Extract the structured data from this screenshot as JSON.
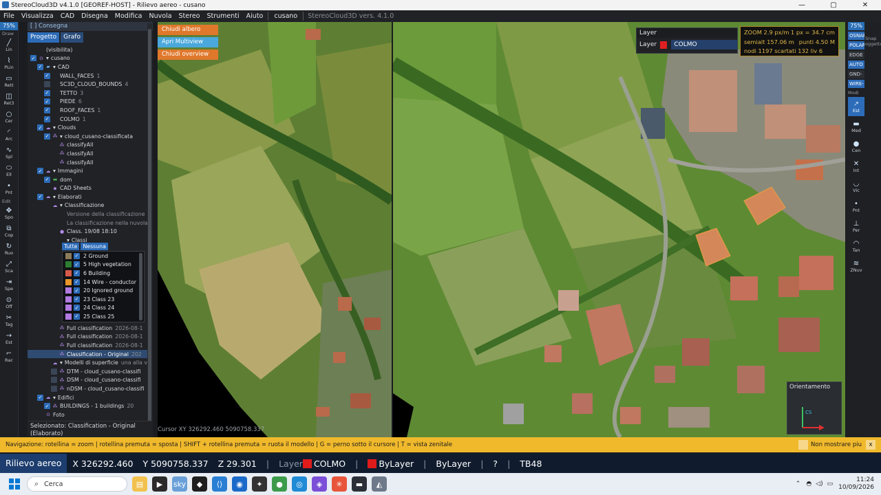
{
  "window": {
    "title": "StereoCloud3D v4.1.0  [GEOREF-HOST]  - Rilievo aereo  - cusano",
    "controls": [
      "—",
      "▢",
      "✕"
    ]
  },
  "menu": {
    "items": [
      "File",
      "Visualizza",
      "CAD",
      "Disegna",
      "Modifica",
      "Nuvola",
      "Stereo",
      "Strumenti",
      "Aiuto"
    ],
    "project_tab": "cusano",
    "version": "StereoCloud3D vers. 4.1.0"
  },
  "left_tools": {
    "zoom": "75%",
    "group_draw": "Draw",
    "group_edit": "Edit",
    "draw": [
      {
        "g": "╱",
        "l": "Lin"
      },
      {
        "g": "⌇",
        "l": "PLin"
      },
      {
        "g": "▭",
        "l": "Rett"
      },
      {
        "g": "◫",
        "l": "Ret3"
      },
      {
        "g": "○",
        "l": "Cer"
      },
      {
        "g": "◜",
        "l": "Arc"
      },
      {
        "g": "∿",
        "l": "Spl"
      },
      {
        "g": "⬭",
        "l": "Ell"
      },
      {
        "g": "•",
        "l": "Pnt"
      }
    ],
    "edit": [
      {
        "g": "✥",
        "l": "Spo"
      },
      {
        "g": "⧉",
        "l": "Cop"
      },
      {
        "g": "↻",
        "l": "Ruo"
      },
      {
        "g": "⤢",
        "l": "Sca"
      },
      {
        "g": "⇥",
        "l": "Spe"
      },
      {
        "g": "⊙",
        "l": "Off"
      },
      {
        "g": "✂",
        "l": "Tag"
      },
      {
        "g": "→",
        "l": "Est"
      },
      {
        "g": "⌐",
        "l": "Rac"
      }
    ]
  },
  "panel": {
    "header": "[ ] Consegna",
    "tabs": [
      "Progetto",
      "Grafo"
    ],
    "tree": [
      {
        "d": 0,
        "ck": 0,
        "ico": "",
        "t": "(visibilita)",
        "c": ""
      },
      {
        "d": 0,
        "ck": 1,
        "ico": "⊙",
        "arr": "▾",
        "t": "cusano",
        "c": ""
      },
      {
        "d": 1,
        "ck": 1,
        "ico": "▰",
        "arr": "▾",
        "t": "CAD",
        "c": ""
      },
      {
        "d": 2,
        "ck": 1,
        "ico": "",
        "t": "WALL_FACES",
        "c": "1"
      },
      {
        "d": 2,
        "ck": 2,
        "ico": "",
        "t": "SC3D_CLOUD_BOUNDS",
        "c": "4"
      },
      {
        "d": 2,
        "ck": 1,
        "ico": "",
        "t": "TETTO",
        "c": "3"
      },
      {
        "d": 2,
        "ck": 1,
        "ico": "",
        "t": "PIEDE",
        "c": "6"
      },
      {
        "d": 2,
        "ck": 1,
        "ico": "",
        "t": "ROOF_FACES",
        "c": "1"
      },
      {
        "d": 2,
        "ck": 1,
        "ico": "",
        "t": "COLMO",
        "c": "1"
      },
      {
        "d": 1,
        "ck": 1,
        "ico": "☁",
        "arr": "▾",
        "t": "Clouds",
        "c": ""
      },
      {
        "d": 2,
        "ck": 1,
        "ico": "⁂",
        "arr": "▾",
        "t": "cloud_cusano-classificata",
        "c": ""
      },
      {
        "d": 3,
        "ck": 0,
        "ico": "⁂",
        "t": "classifyAll",
        "c": ""
      },
      {
        "d": 3,
        "ck": 0,
        "ico": "⁂",
        "t": "classifyAll",
        "c": ""
      },
      {
        "d": 3,
        "ck": 0,
        "ico": "⁂",
        "t": "classifyAll",
        "c": ""
      },
      {
        "d": 1,
        "ck": 1,
        "ico": "☁",
        "arr": "▾",
        "t": "Immagini",
        "c": ""
      },
      {
        "d": 2,
        "ck": 1,
        "ico": "▬",
        "t": "dom",
        "c": ""
      },
      {
        "d": 2,
        "ck": 0,
        "ico": "▪",
        "t": "CAD Sheets",
        "c": ""
      },
      {
        "d": 1,
        "ck": 1,
        "ico": "☁",
        "arr": "▾",
        "t": "Elaborati",
        "c": ""
      },
      {
        "d": 2,
        "ck": 0,
        "ico": "☁",
        "arr": "▾",
        "t": "Classificazione",
        "c": ""
      },
      {
        "d": 3,
        "ck": 0,
        "ico": "",
        "t": "Versione della classificazione",
        "c": "",
        "dim": 1
      },
      {
        "d": 3,
        "ck": 0,
        "ico": "",
        "t": "La classificazione nella nuvola non corri",
        "c": "",
        "dim": 1
      },
      {
        "d": 3,
        "ck": 0,
        "ico": "●",
        "t": "Class. 19/08 18:10",
        "c": ""
      },
      {
        "d": 3,
        "ck": 0,
        "ico": "",
        "arr": "▾",
        "t": "Classi",
        "c": ""
      }
    ],
    "class_buttons": [
      "Tutte",
      "Nessuna"
    ],
    "classes": [
      {
        "c": "#8b7b5a",
        "t": "2  Ground"
      },
      {
        "c": "#2e7d32",
        "t": "5  High vegetation"
      },
      {
        "c": "#d65a4a",
        "t": "6  Building"
      },
      {
        "c": "#e8952a",
        "t": "14  Wire - conductor"
      },
      {
        "c": "#b07ae0",
        "t": "20  Ignored ground"
      },
      {
        "c": "#b07ae0",
        "t": "23  Class 23"
      },
      {
        "c": "#b07ae0",
        "t": "24  Class 24"
      },
      {
        "c": "#b07ae0",
        "t": "25  Class 25"
      }
    ],
    "tree2": [
      {
        "d": 3,
        "ck": 0,
        "ico": "⁂",
        "t": "Full classification",
        "c": "2026-08-1",
        "sel": 0
      },
      {
        "d": 3,
        "ck": 0,
        "ico": "⁂",
        "t": "Full classification",
        "c": "2026-08-1",
        "sel": 0
      },
      {
        "d": 3,
        "ck": 0,
        "ico": "⁂",
        "t": "Full classification",
        "c": "2026-08-1",
        "sel": 0
      },
      {
        "d": 3,
        "ck": 0,
        "ico": "⁂",
        "t": "Classification - Original",
        "c": "202",
        "sel": 1
      },
      {
        "d": 2,
        "ck": 0,
        "ico": "☁",
        "arr": "▾",
        "t": "Modelli di superficie",
        "c": "una alla v",
        "sel": 0
      },
      {
        "d": 3,
        "ck": 2,
        "ico": "⁂",
        "t": "DTM - cloud_cusano-classifi",
        "c": "",
        "sel": 0
      },
      {
        "d": 3,
        "ck": 2,
        "ico": "⁂",
        "t": "DSM - cloud_cusano-classifi",
        "c": "",
        "sel": 0
      },
      {
        "d": 3,
        "ck": 2,
        "ico": "⁂",
        "t": "nDSM - cloud_cusano-classifi",
        "c": "",
        "sel": 0
      },
      {
        "d": 1,
        "ck": 1,
        "ico": "☁",
        "arr": "▾",
        "t": "Edifici",
        "c": "",
        "sel": 0
      },
      {
        "d": 2,
        "ck": 1,
        "ico": "⁂",
        "t": "BUILDINGS - 1 buildings",
        "c": "20",
        "sel": 0
      },
      {
        "d": 1,
        "ck": 0,
        "ico": "⊙",
        "t": "Foto",
        "c": "",
        "sel": 0
      }
    ],
    "selected": "Selezionato: Classification - Original (Elaborato)"
  },
  "viewport_left": {
    "buttons": [
      {
        "t": "Chiudi albero scena",
        "c": "#e0782c"
      },
      {
        "t": "Apri Multiview",
        "c": "#4aa8dc"
      },
      {
        "t": "Chiudi overview",
        "c": "#e0782c"
      }
    ],
    "cursor": "Cursor XY  326292.460  5090758.337"
  },
  "layer": {
    "title": "Layer",
    "label": "Layer",
    "value": "COLMO",
    "color": "#e02020"
  },
  "zoom_info": {
    "l1a": "ZOOM  2.9 px/m",
    "l1b": "1 px = 34.7 cm",
    "l2a": "semialt 157.06 m",
    "l2b": "punti 4.50 M",
    "l3": "nodi 1197  scartati 132  liv 6"
  },
  "snap": {
    "zoom": "75%",
    "title": "Snap oggetto",
    "items": [
      {
        "t": "OSNAP",
        "on": 1
      },
      {
        "t": "POLAR",
        "on": 1
      },
      {
        "t": "EDGE",
        "on": 0
      },
      {
        "t": "AUTO",
        "on": 1
      },
      {
        "t": "GND-Z",
        "on": 0
      },
      {
        "t": "WIRE-Z",
        "on": 1
      }
    ],
    "mod_label": "Modi",
    "tools": [
      {
        "g": "↗",
        "l": "Est",
        "on": 1
      },
      {
        "g": "▬",
        "l": "Med",
        "on": 0
      },
      {
        "g": "●",
        "l": "Cen",
        "on": 0
      },
      {
        "g": "✕",
        "l": "Int",
        "on": 0
      },
      {
        "g": "◡",
        "l": "Vic",
        "on": 0
      },
      {
        "g": "•",
        "l": "Pnt",
        "on": 0
      },
      {
        "g": "⊥",
        "l": "Per",
        "on": 0
      },
      {
        "g": "◠",
        "l": "Tan",
        "on": 0
      },
      {
        "g": "≋",
        "l": "ZNuv",
        "on": 0
      }
    ]
  },
  "orientation": {
    "title": "Orientamento",
    "cs": "CS"
  },
  "navbar": {
    "text": "Navigazione:  rotellina = zoom   |   rotellina premuta = sposta   |   SHIFT + rotellina premuta = ruota il modello   |   G = perno sotto il cursore   |   T = vista zenitale",
    "dont_show": "Non mostrare piu",
    "close": "x"
  },
  "status": {
    "mode": "Rilievo aereo",
    "x": "X 326292.460",
    "y": "Y 5090758.337",
    "z": "Z 29.301",
    "layer_lbl": "Layer",
    "layer": "COLMO",
    "bylayer1": "ByLayer",
    "bylayer2": "ByLayer",
    "help": "?",
    "tb": "TB48",
    "sep": "|"
  },
  "taskbar": {
    "search": "Cerca",
    "time": "11:24",
    "date": "10/09/2026",
    "apps": [
      {
        "g": "▤",
        "c": "#f2c14e"
      },
      {
        "g": "▶",
        "c": "#2b2b2b"
      },
      {
        "g": "sky",
        "c": "#6aa0d8"
      },
      {
        "g": "◆",
        "c": "#1f1f1f"
      },
      {
        "g": "⟨⟩",
        "c": "#2a7fd4"
      },
      {
        "g": "◉",
        "c": "#1b6ac9"
      },
      {
        "g": "✦",
        "c": "#333"
      },
      {
        "g": "●",
        "c": "#3c9b4a"
      },
      {
        "g": "◎",
        "c": "#1f8ad6"
      },
      {
        "g": "◈",
        "c": "#7b4fd8"
      },
      {
        "g": "✳",
        "c": "#e8553a"
      },
      {
        "g": "▬",
        "c": "#2b2f38"
      },
      {
        "g": "◭",
        "c": "#6e7a8a"
      }
    ]
  }
}
